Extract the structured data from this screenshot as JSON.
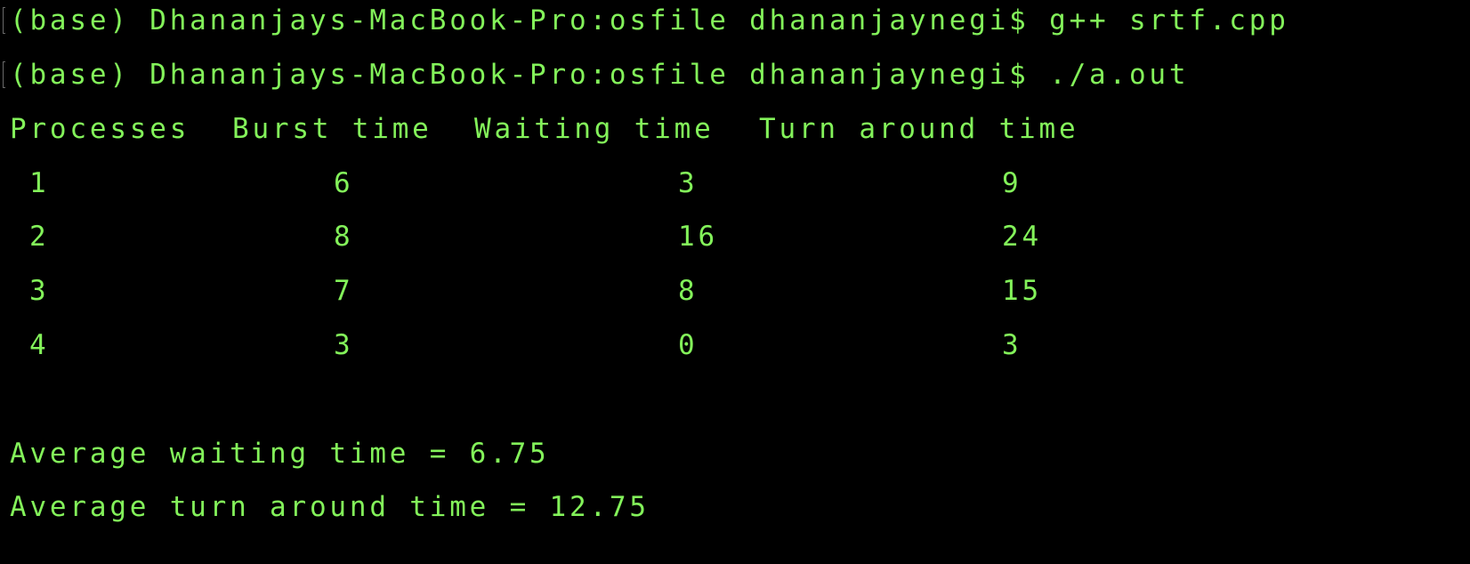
{
  "terminal": {
    "prompt_1": "(base) Dhananjays-MacBook-Pro:osfile dhananjaynegi$ g++ srtf.cpp",
    "prompt_2": "(base) Dhananjays-MacBook-Pro:osfile dhananjaynegi$ ./a.out",
    "table": {
      "headers": [
        "Processes",
        "Burst time",
        "Waiting time",
        "Turn around time"
      ],
      "rows": [
        [
          "1",
          "6",
          "3",
          "9"
        ],
        [
          "2",
          "8",
          "16",
          "24"
        ],
        [
          "3",
          "7",
          "8",
          "15"
        ],
        [
          "4",
          "3",
          "0",
          "3"
        ]
      ]
    },
    "avg_waiting": "Average waiting time = 6.75",
    "avg_turnaround": "Average turn around time = 12.75"
  },
  "colors": {
    "background": "#000000",
    "text": "#83f25a"
  }
}
